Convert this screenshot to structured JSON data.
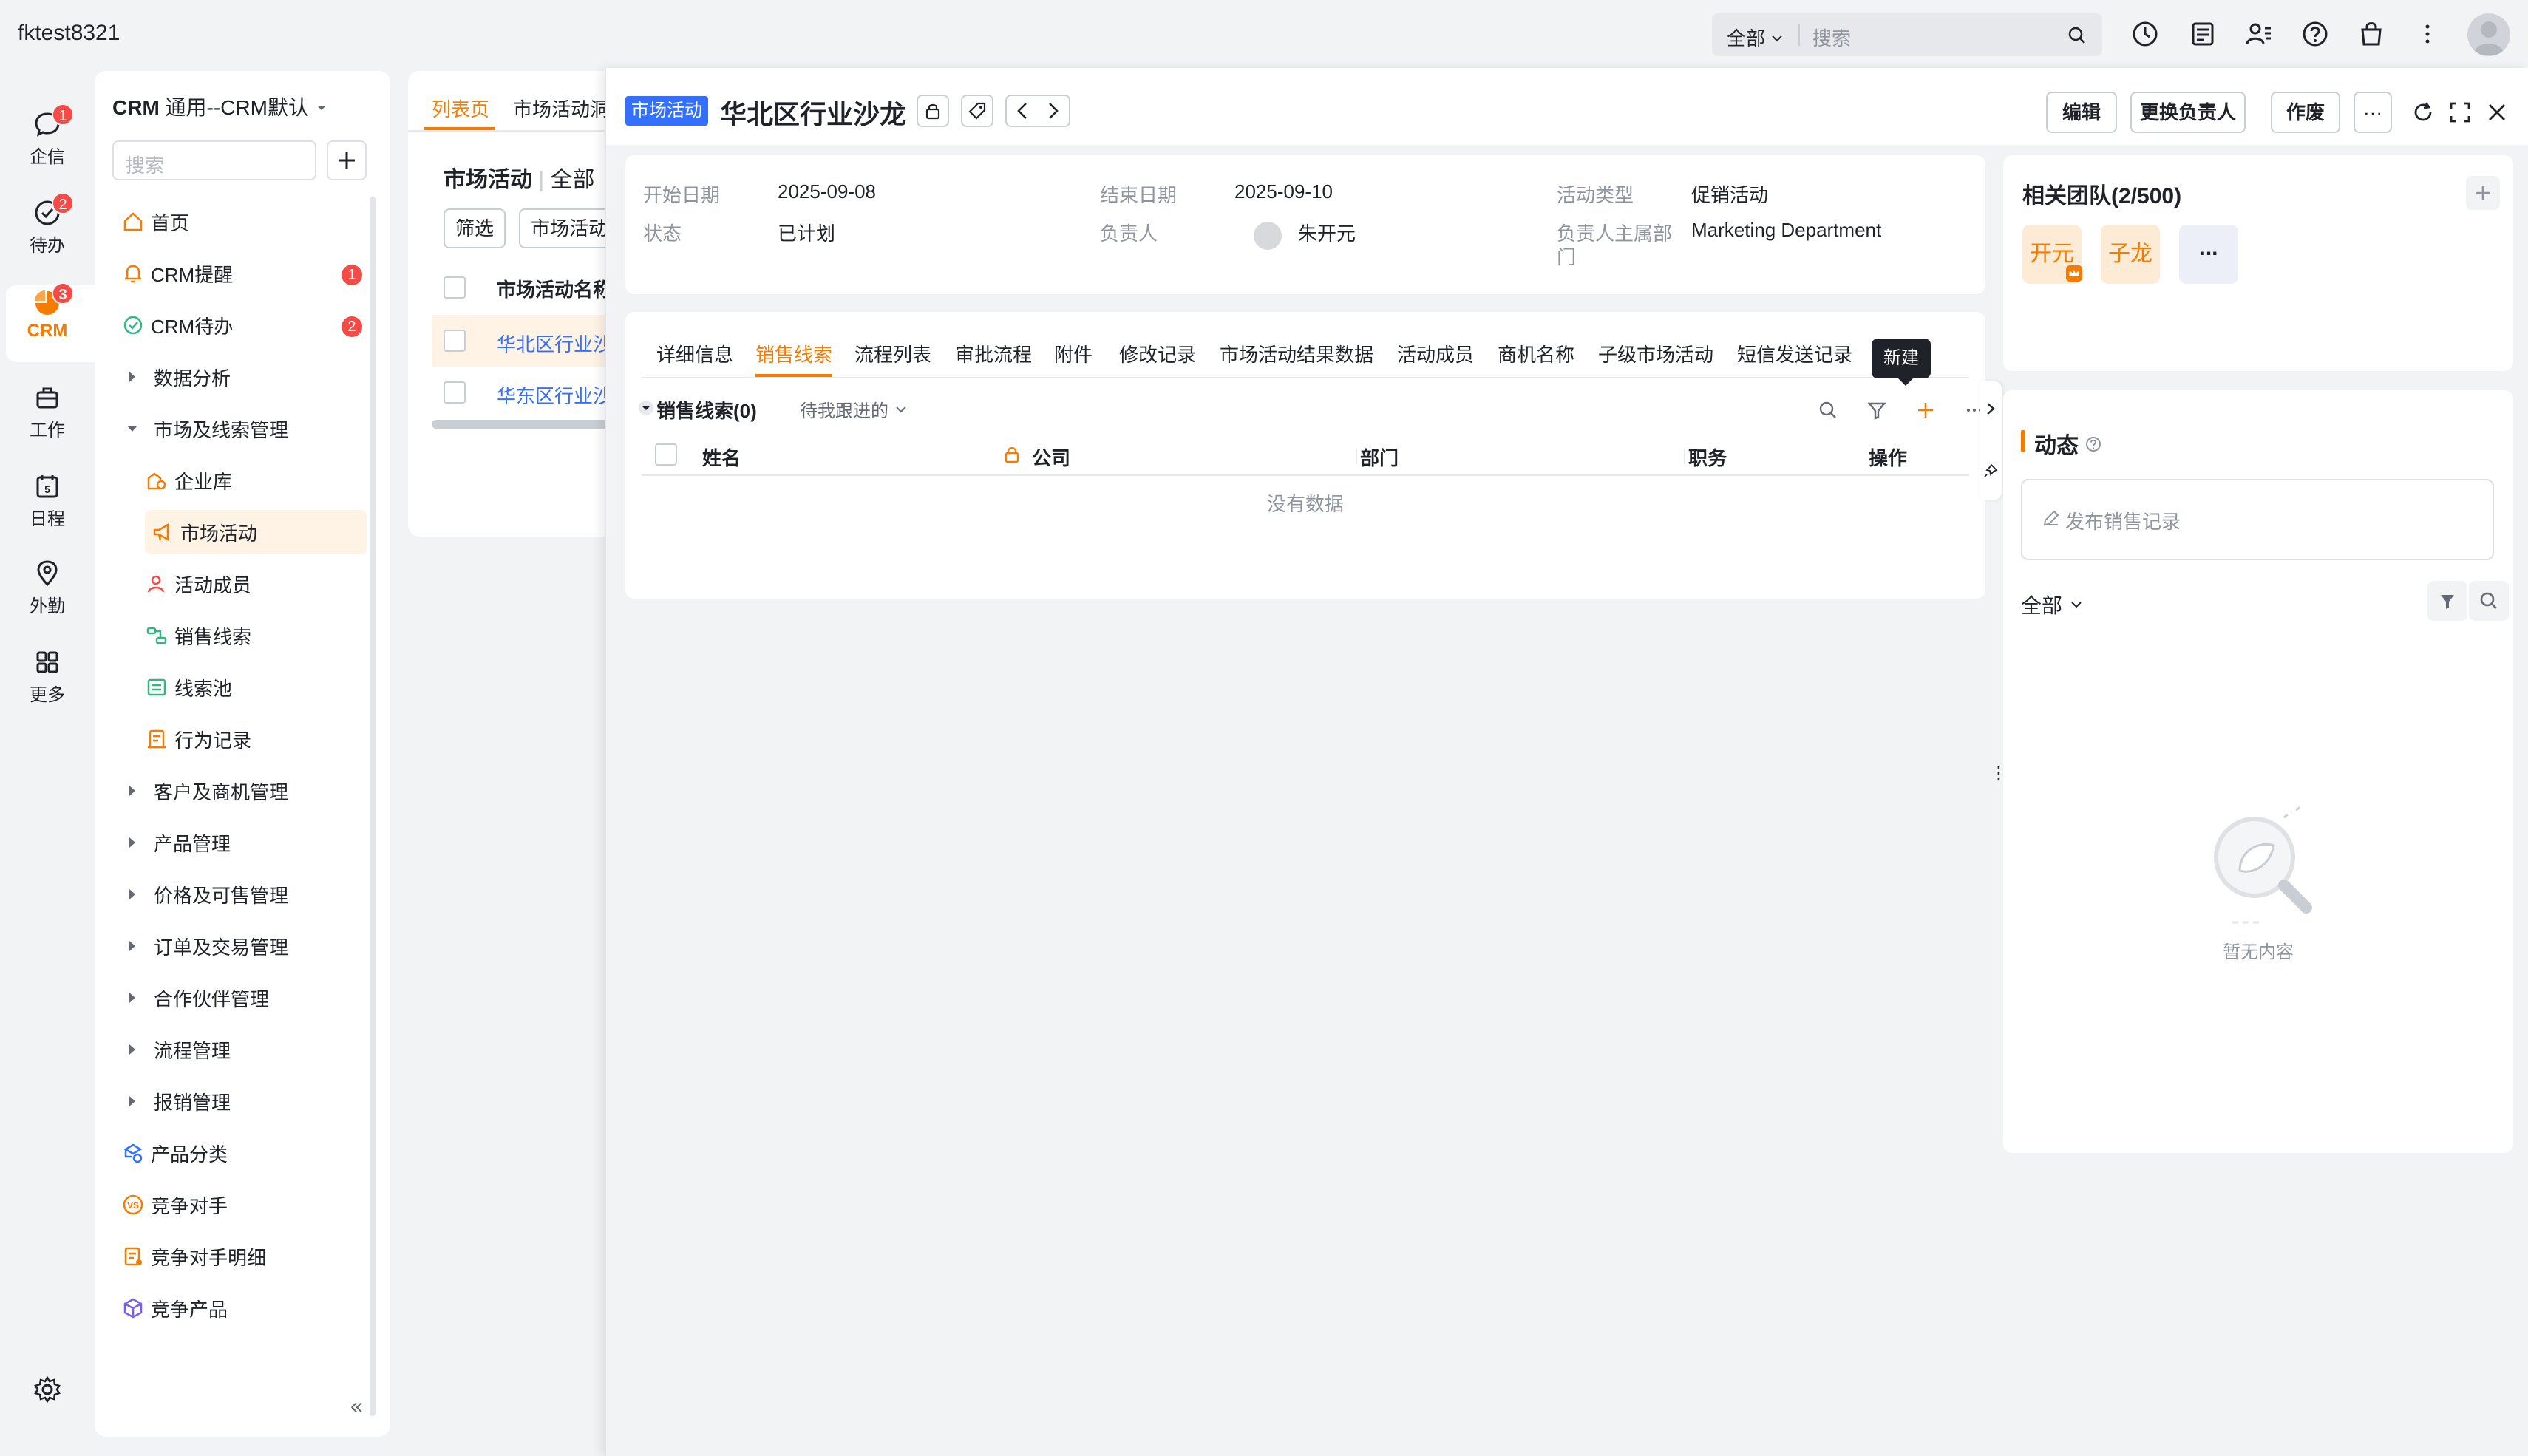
{
  "account": "fktest8321",
  "global_search": {
    "scope": "全部",
    "placeholder": "搜索"
  },
  "rail": [
    {
      "label": "企信",
      "badge": "1"
    },
    {
      "label": "待办",
      "badge": "2"
    },
    {
      "label": "CRM",
      "badge": "3"
    },
    {
      "label": "工作",
      "badge": ""
    },
    {
      "label": "日程",
      "badge": ""
    },
    {
      "label": "外勤",
      "badge": ""
    },
    {
      "label": "更多",
      "badge": ""
    }
  ],
  "nav": {
    "app": "CRM",
    "view": "通用--CRM默认",
    "search_placeholder": "搜索",
    "items": [
      {
        "label": "首页"
      },
      {
        "label": "CRM提醒",
        "badge": "1"
      },
      {
        "label": "CRM待办",
        "badge": "2"
      },
      {
        "label": "数据分析"
      },
      {
        "label": "市场及线索管理"
      },
      {
        "label": "企业库"
      },
      {
        "label": "市场活动"
      },
      {
        "label": "活动成员"
      },
      {
        "label": "销售线索"
      },
      {
        "label": "线索池"
      },
      {
        "label": "行为记录"
      },
      {
        "label": "客户及商机管理"
      },
      {
        "label": "产品管理"
      },
      {
        "label": "价格及可售管理"
      },
      {
        "label": "订单及交易管理"
      },
      {
        "label": "合作伙伴管理"
      },
      {
        "label": "流程管理"
      },
      {
        "label": "报销管理"
      },
      {
        "label": "产品分类"
      },
      {
        "label": "竞争对手"
      },
      {
        "label": "竞争对手明细"
      },
      {
        "label": "竞争产品"
      }
    ],
    "collapse": "«"
  },
  "list": {
    "tabs": [
      "列表页",
      "市场活动洞"
    ],
    "title": "市场活动",
    "scope": "全部",
    "filter_button": "筛选",
    "filter_chip": "市场活动",
    "column": "市场活动名称",
    "rows": [
      "华北区行业沙",
      "华东区行业沙"
    ]
  },
  "detail": {
    "object_tag": "市场活动",
    "title": "华北区行业沙龙",
    "buttons": {
      "edit": "编辑",
      "change_owner": "更换负责人",
      "void": "作废",
      "more": "···"
    },
    "fields": {
      "start_label": "开始日期",
      "start_value": "2025-09-08",
      "end_label": "结束日期",
      "end_value": "2025-09-10",
      "type_label": "活动类型",
      "type_value": "促销活动",
      "status_label": "状态",
      "status_value": "已计划",
      "owner_label": "负责人",
      "owner_value": "朱开元",
      "dept_label_1": "负责人主属部",
      "dept_label_2": "门",
      "dept_value": "Marketing Department"
    },
    "tabs": [
      "详细信息",
      "销售线索",
      "流程列表",
      "审批流程",
      "附件",
      "修改记录",
      "市场活动结果数据",
      "活动成员",
      "商机名称",
      "子级市场活动",
      "短信发送记录"
    ],
    "active_tab": "销售线索",
    "tooltip": "新建",
    "section": {
      "title": "销售线索(0)",
      "filter": "待我跟进的"
    },
    "columns": [
      "姓名",
      "公司",
      "部门",
      "职务",
      "操作"
    ],
    "empty": "没有数据"
  },
  "team": {
    "title": "相关团队(2/500)",
    "members": [
      "开元",
      "子龙"
    ],
    "more": "..."
  },
  "activity": {
    "title": "动态",
    "post_placeholder": "发布销售记录",
    "filter": "全部",
    "empty": "暂无内容"
  },
  "colors": {
    "accent": "#f57c00",
    "link": "#3370ff",
    "badge": "#f54a45"
  }
}
